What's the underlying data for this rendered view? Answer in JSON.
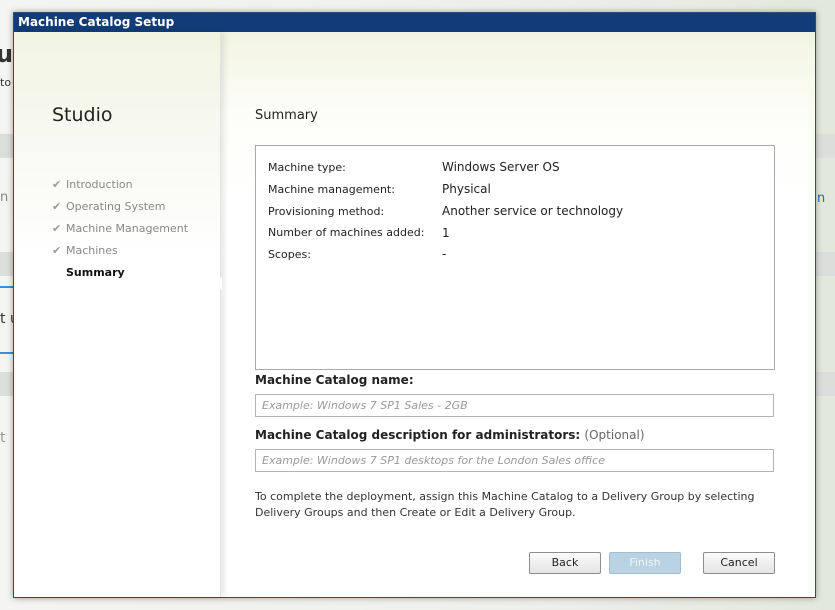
{
  "background": {
    "fragments": [
      "u",
      "to",
      "n",
      "t u",
      "t",
      "n"
    ]
  },
  "dialog": {
    "title": "Machine Catalog Setup",
    "brand": "Studio",
    "steps": [
      {
        "label": "Introduction",
        "status": "done"
      },
      {
        "label": "Operating System",
        "status": "done"
      },
      {
        "label": "Machine Management",
        "status": "done"
      },
      {
        "label": "Machines",
        "status": "done"
      },
      {
        "label": "Summary",
        "status": "current"
      }
    ],
    "check_glyph": "✔",
    "section_title": "Summary",
    "summary": [
      {
        "label": "Machine type:",
        "value": "Windows Server OS"
      },
      {
        "label": "Machine management:",
        "value": "Physical"
      },
      {
        "label": "Provisioning method:",
        "value": "Another service or technology"
      },
      {
        "label": "Number of machines added:",
        "value": "1"
      },
      {
        "label": "Scopes:",
        "value": "-"
      }
    ],
    "catalog_name": {
      "label": "Machine Catalog name:",
      "value": "",
      "placeholder": "Example: Windows 7 SP1 Sales - 2GB"
    },
    "catalog_description": {
      "label": "Machine Catalog description for administrators:",
      "optional": "(Optional)",
      "value": "",
      "placeholder": "Example: Windows 7 SP1 desktops for the London Sales office"
    },
    "note": "To complete the deployment, assign this Machine Catalog to a Delivery Group by selecting Delivery Groups and then Create or Edit a Delivery Group.",
    "buttons": {
      "back": "Back",
      "finish": "Finish",
      "cancel": "Cancel"
    }
  },
  "colors": {
    "titlebar": "#123c78",
    "finish_disabled": "#b9d3e3"
  }
}
